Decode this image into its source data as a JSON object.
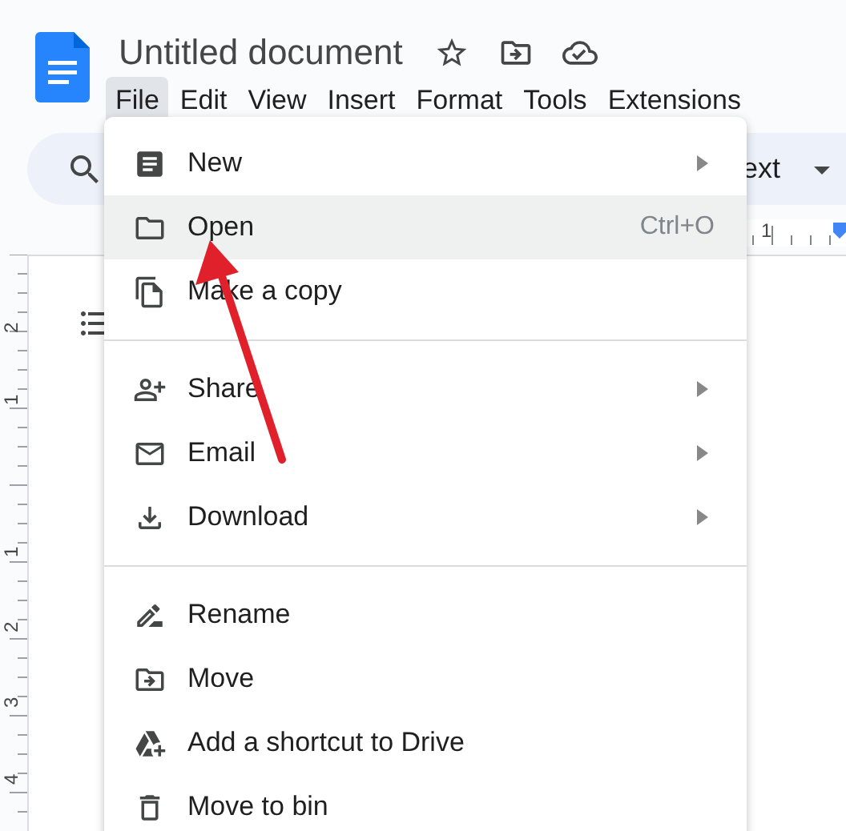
{
  "document": {
    "title": "Untitled document"
  },
  "menu_bar": [
    {
      "label": "File",
      "selected": true
    },
    {
      "label": "Edit",
      "selected": false
    },
    {
      "label": "View",
      "selected": false
    },
    {
      "label": "Insert",
      "selected": false
    },
    {
      "label": "Format",
      "selected": false
    },
    {
      "label": "Tools",
      "selected": false
    },
    {
      "label": "Extensions",
      "selected": false
    }
  ],
  "toolbar": {
    "style_dropdown": "ext"
  },
  "horizontal_ruler": {
    "labels": [
      "1"
    ]
  },
  "vertical_ruler": {
    "labels": [
      "2",
      "1",
      "1",
      "2",
      "3",
      "4"
    ]
  },
  "file_menu": {
    "sections": [
      {
        "items": [
          {
            "label": "New",
            "submenu": true,
            "selected": false
          },
          {
            "label": "Open",
            "shortcut": "Ctrl+O",
            "submenu": false,
            "selected": true
          },
          {
            "label": "Make a copy",
            "submenu": false,
            "selected": false
          }
        ]
      },
      {
        "items": [
          {
            "label": "Share",
            "submenu": true,
            "selected": false
          },
          {
            "label": "Email",
            "submenu": true,
            "selected": false
          },
          {
            "label": "Download",
            "submenu": true,
            "selected": false
          }
        ]
      },
      {
        "items": [
          {
            "label": "Rename",
            "submenu": false,
            "selected": false
          },
          {
            "label": "Move",
            "submenu": false,
            "selected": false
          },
          {
            "label": "Add a shortcut to Drive",
            "submenu": false,
            "selected": false
          },
          {
            "label": "Move to bin",
            "submenu": false,
            "selected": false
          }
        ]
      }
    ]
  }
}
